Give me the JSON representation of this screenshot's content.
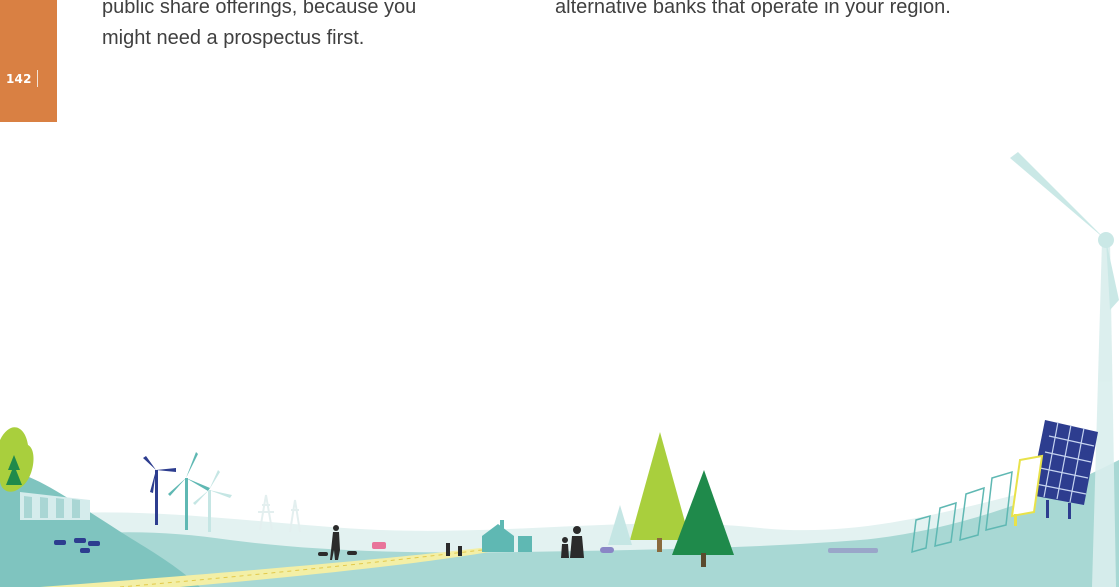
{
  "page": {
    "number": "142",
    "separator": "|"
  },
  "left_column": {
    "line1": "public share offerings, because you",
    "line2": "might need a prospectus first."
  },
  "right_column": {
    "line1": "alternative banks that operate in your region."
  },
  "colors": {
    "page_tab": "#d98043",
    "ground": "#a8d8d4",
    "path": "#f3efa6",
    "wind_turbine": "#c5e6e4",
    "solar_panel": "#2d3d8f",
    "tree_dark": "#1f8a4b",
    "tree_light": "#a9cf3d"
  },
  "illustration": {
    "subject": "renewable energy landscape",
    "icons": [
      "wind-turbine-icon",
      "solar-panel-icon",
      "tree-icon",
      "person-icon",
      "dog-icon",
      "cow-icon",
      "house-icon",
      "car-icon",
      "dam-icon",
      "pylon-icon"
    ]
  }
}
